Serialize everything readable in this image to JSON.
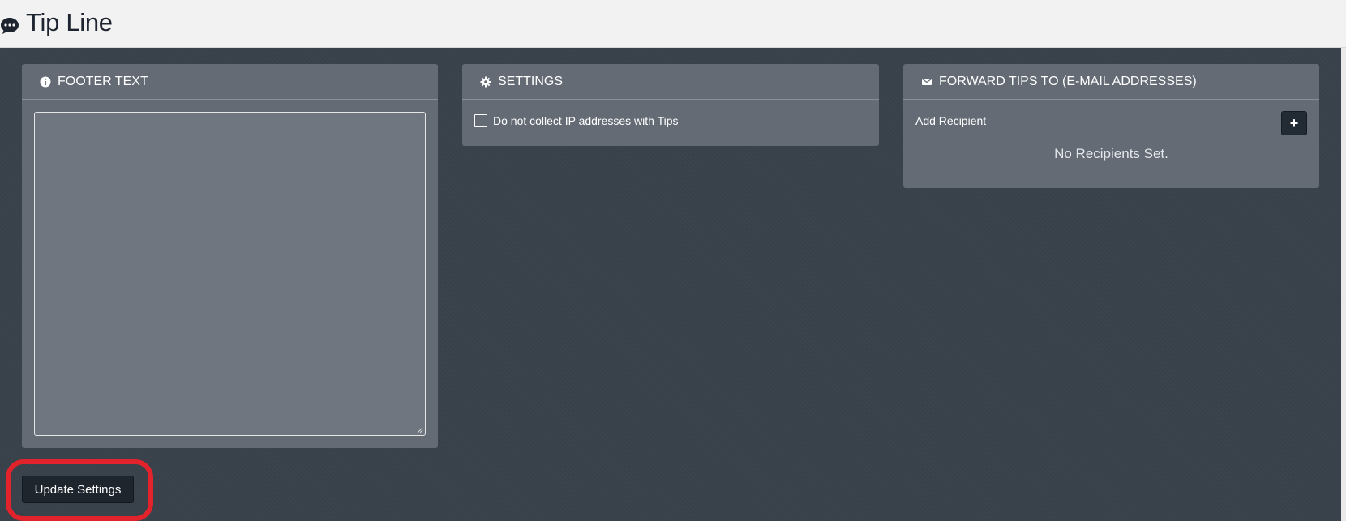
{
  "header": {
    "title": "Tip Line",
    "icon": "chat-bubble-icon"
  },
  "panels": {
    "footer": {
      "title": "FOOTER TEXT",
      "icon": "info-icon",
      "textarea_value": ""
    },
    "settings": {
      "title": "SETTINGS",
      "icon": "gear-icon",
      "checkbox_label": "Do not collect IP addresses with Tips",
      "checkbox_checked": false
    },
    "forward": {
      "title": "FORWARD TIPS TO (E-MAIL ADDRESSES)",
      "icon": "envelope-icon",
      "add_label": "Add Recipient",
      "add_button": "+",
      "empty_text": "No Recipients Set."
    }
  },
  "actions": {
    "update_label": "Update Settings"
  },
  "colors": {
    "background": "#394049",
    "panel": "#646b75",
    "highlight": "#e3232b",
    "button": "#1f252d"
  }
}
